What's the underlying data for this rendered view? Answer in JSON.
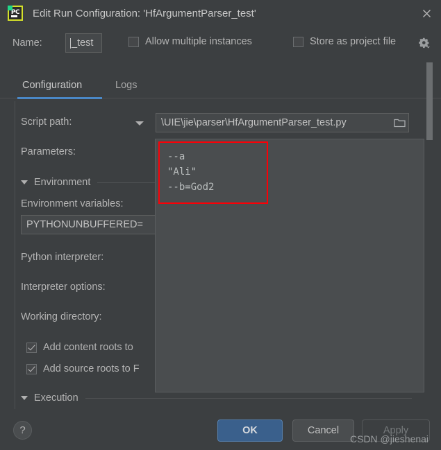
{
  "window": {
    "title": "Edit Run Configuration: 'HfArgumentParser_test'",
    "app_icon": "pycharm-icon",
    "close_icon": "close-icon"
  },
  "name_row": {
    "label": "Name:",
    "value": "_test",
    "allow_multiple_instances": {
      "label": "Allow multiple instances",
      "checked": false
    },
    "store_as_project_file": {
      "label": "Store as project file",
      "checked": false
    },
    "gear_icon": "gear-icon"
  },
  "tabs": [
    {
      "label": "Configuration",
      "selected": true
    },
    {
      "label": "Logs",
      "selected": false
    }
  ],
  "form": {
    "script_path": {
      "label": "Script path:",
      "value": "\\UIE\\jie\\parser\\HfArgumentParser_test.py",
      "browse_icon": "folder-icon",
      "dropdown_icon": "chevron-down-icon"
    },
    "parameters": {
      "label": "Parameters:"
    },
    "environment_section": {
      "label": "Environment",
      "expanded": true
    },
    "environment_variables": {
      "label": "Environment variables:",
      "value": "PYTHONUNBUFFERED="
    },
    "python_interpreter": {
      "label": "Python interpreter:"
    },
    "interpreter_options": {
      "label": "Interpreter options:"
    },
    "working_directory": {
      "label": "Working directory:"
    },
    "add_content_roots": {
      "label": "Add content roots to",
      "checked": true
    },
    "add_source_roots": {
      "label": "Add source roots to F",
      "checked": true
    },
    "execution_section": {
      "label": "Execution",
      "expanded": true
    }
  },
  "parameters_popup": {
    "lines": [
      "--a",
      "\"Ali\"",
      "--b=God2"
    ],
    "highlight_color": "#fb0007"
  },
  "bottom": {
    "help_label": "?",
    "ok_label": "OK",
    "cancel_label": "Cancel",
    "apply_label": "Apply",
    "apply_enabled": false
  },
  "watermark": "CSDN @jieshenai",
  "colors": {
    "dialog_bg": "#3c3f41",
    "field_bg": "#45484a",
    "accent_blue": "#4a88c7",
    "ok_button": "#3a608c",
    "highlight_red": "#fb0007"
  }
}
